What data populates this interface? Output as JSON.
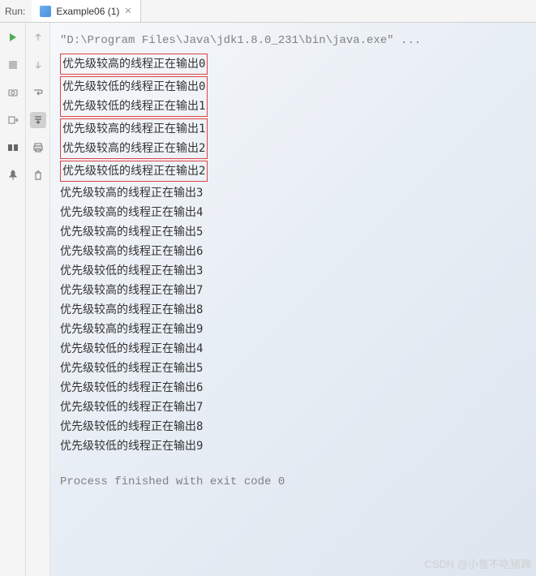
{
  "header": {
    "run_label": "Run:",
    "tab_label": "Example06 (1)"
  },
  "cmd": "\"D:\\Program Files\\Java\\jdk1.8.0_231\\bin\\java.exe\" ...",
  "output": [
    {
      "text": "优先级较高的线程正在输出0",
      "box_start": true,
      "box_end": true
    },
    {
      "text": "优先级较低的线程正在输出0",
      "box_start": true
    },
    {
      "text": "优先级较低的线程正在输出1",
      "box_end": true
    },
    {
      "text": "优先级较高的线程正在输出1",
      "box_start": true
    },
    {
      "text": "优先级较高的线程正在输出2",
      "box_end": true
    },
    {
      "text": "优先级较低的线程正在输出2",
      "box_start": true,
      "box_end": true
    },
    {
      "text": "优先级较高的线程正在输出3"
    },
    {
      "text": "优先级较高的线程正在输出4"
    },
    {
      "text": "优先级较高的线程正在输出5"
    },
    {
      "text": "优先级较高的线程正在输出6"
    },
    {
      "text": "优先级较低的线程正在输出3"
    },
    {
      "text": "优先级较高的线程正在输出7"
    },
    {
      "text": "优先级较高的线程正在输出8"
    },
    {
      "text": "优先级较高的线程正在输出9"
    },
    {
      "text": "优先级较低的线程正在输出4"
    },
    {
      "text": "优先级较低的线程正在输出5"
    },
    {
      "text": "优先级较低的线程正在输出6"
    },
    {
      "text": "优先级较低的线程正在输出7"
    },
    {
      "text": "优先级较低的线程正在输出8"
    },
    {
      "text": "优先级较低的线程正在输出9"
    }
  ],
  "exit_msg": "Process finished with exit code 0",
  "watermark": "CSDN @小鲁不吃猪蹄"
}
